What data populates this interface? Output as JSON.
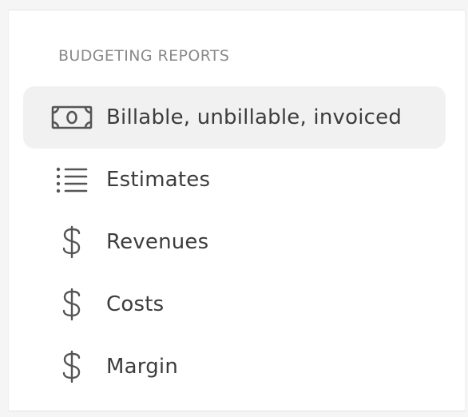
{
  "section": {
    "heading": "BUDGETING REPORTS"
  },
  "menu": {
    "items": [
      {
        "label": "Billable, unbillable, invoiced",
        "icon": "banknote-icon",
        "active": true
      },
      {
        "label": "Estimates",
        "icon": "list-icon",
        "active": false
      },
      {
        "label": "Revenues",
        "icon": "dollar-icon",
        "active": false
      },
      {
        "label": "Costs",
        "icon": "dollar-icon",
        "active": false
      },
      {
        "label": "Margin",
        "icon": "dollar-icon",
        "active": false
      }
    ]
  },
  "colors": {
    "active_background": "#f1f1f1",
    "heading_text": "#8a8a8a",
    "item_text": "#3c3c3c",
    "icon_stroke": "#555555"
  }
}
